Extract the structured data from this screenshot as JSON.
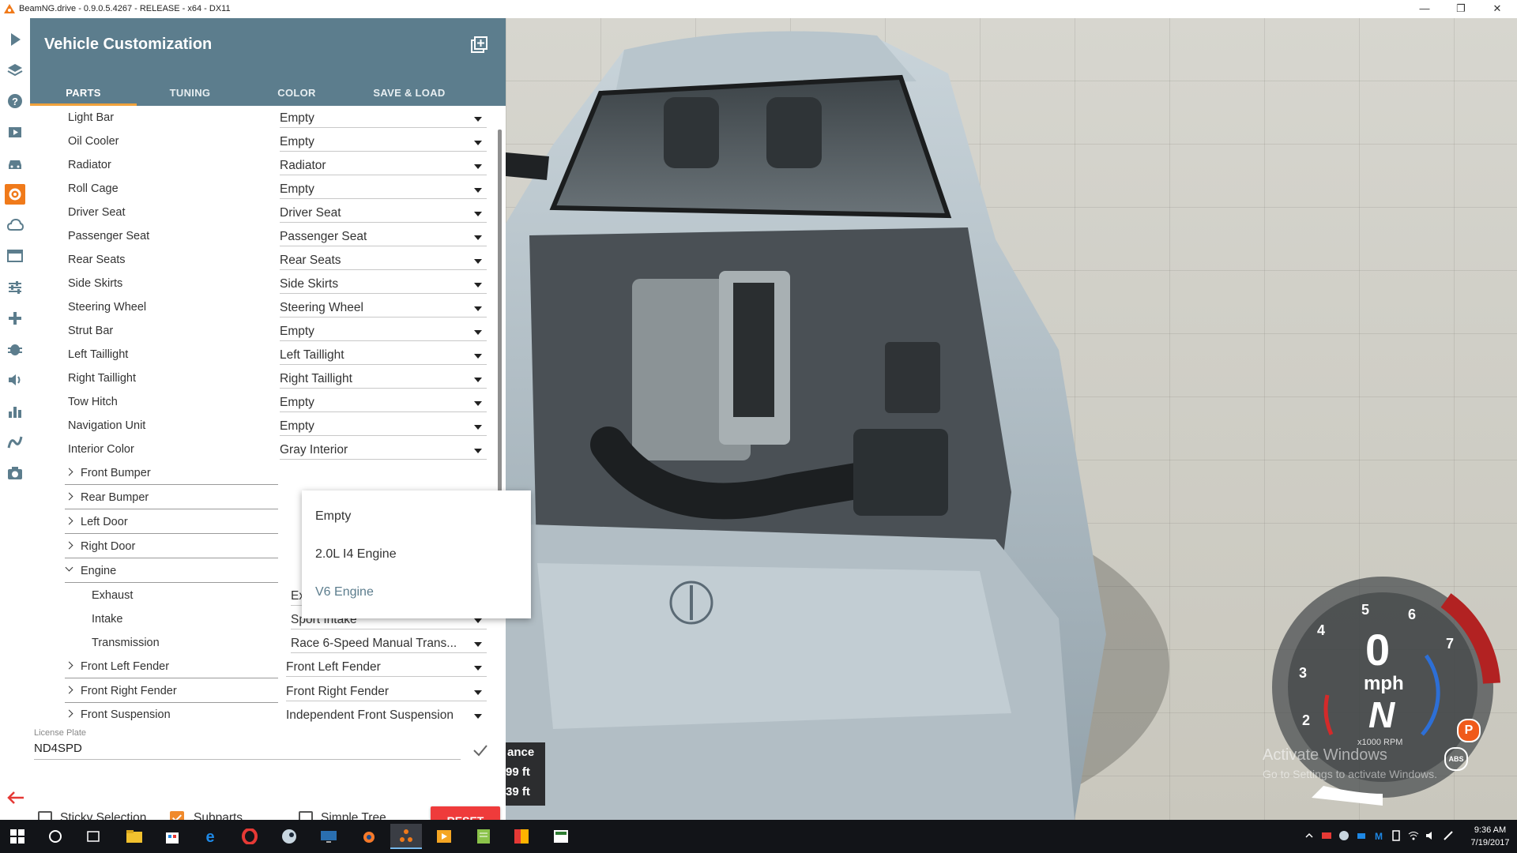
{
  "window": {
    "title": "BeamNG.drive - 0.9.0.5.4267 - RELEASE - x64 - DX11",
    "minimize": "—",
    "restore": "❐",
    "close": "✕"
  },
  "panel": {
    "title": "Vehicle Customization",
    "tabs": [
      "PARTS",
      "TUNING",
      "COLOR",
      "SAVE & LOAD"
    ],
    "active_tab": "PARTS"
  },
  "parts": [
    {
      "label": "Light Bar",
      "value": "Empty"
    },
    {
      "label": "Oil Cooler",
      "value": "Empty"
    },
    {
      "label": "Radiator",
      "value": "Radiator"
    },
    {
      "label": "Roll Cage",
      "value": "Empty"
    },
    {
      "label": "Driver Seat",
      "value": "Driver Seat"
    },
    {
      "label": "Passenger Seat",
      "value": "Passenger Seat"
    },
    {
      "label": "Rear Seats",
      "value": "Rear Seats"
    },
    {
      "label": "Side Skirts",
      "value": "Side Skirts"
    },
    {
      "label": "Steering Wheel",
      "value": "Steering Wheel"
    },
    {
      "label": "Strut Bar",
      "value": "Empty"
    },
    {
      "label": "Left Taillight",
      "value": "Left Taillight"
    },
    {
      "label": "Right Taillight",
      "value": "Right Taillight"
    },
    {
      "label": "Tow Hitch",
      "value": "Empty"
    },
    {
      "label": "Navigation Unit",
      "value": "Empty"
    },
    {
      "label": "Interior Color",
      "value": "Gray Interior"
    }
  ],
  "groups": [
    {
      "label": "Front Bumper"
    },
    {
      "label": "Rear Bumper"
    },
    {
      "label": "Left Door"
    },
    {
      "label": "Right Door"
    },
    {
      "label": "Engine"
    }
  ],
  "engine_subparts": [
    {
      "label": "Exhaust",
      "value": "Exhaust"
    },
    {
      "label": "Intake",
      "value": "Sport Intake"
    },
    {
      "label": "Transmission",
      "value": "Race 6-Speed Manual Trans..."
    }
  ],
  "more_groups": [
    {
      "label": "Front Left Fender",
      "value": "Front Left Fender"
    },
    {
      "label": "Front Right Fender",
      "value": "Front Right Fender"
    },
    {
      "label": "Front Suspension",
      "value": "Independent Front Suspension"
    }
  ],
  "dropdown": {
    "options": [
      "Empty",
      "2.0L I4 Engine",
      "V6 Engine"
    ],
    "selected": "V6 Engine"
  },
  "license": {
    "label": "License Plate",
    "value": "ND4SPD"
  },
  "footer": {
    "sticky_selection": {
      "label": "Sticky Selection",
      "checked": false
    },
    "subparts": {
      "label": "Subparts",
      "checked": true
    },
    "simple_tree": {
      "label": "Simple Tree",
      "checked": false
    },
    "reset": "RESET"
  },
  "distance": {
    "label": "ance",
    "lines": [
      "99 ft",
      "39 ft"
    ]
  },
  "gauge": {
    "speed": "0",
    "unit": "mph",
    "gear": "N",
    "rpm_label": "x1000 RPM",
    "ticks": [
      "2",
      "3",
      "4",
      "5",
      "6",
      "7"
    ],
    "parking": "P",
    "abs": "ABS"
  },
  "watermark": {
    "line1": "Activate Windows",
    "line2": "Go to Settings to activate Windows."
  },
  "clock": {
    "time": "9:36 AM",
    "date": "7/19/2017"
  },
  "rail_icons": [
    "play-icon",
    "layers-icon",
    "help-icon",
    "video-icon",
    "car-icon",
    "parts-icon",
    "cloud-icon",
    "window-icon",
    "sliders-icon",
    "gamepad-icon",
    "bug-icon",
    "sound-icon",
    "stats-icon",
    "road-icon",
    "camera-icon"
  ],
  "accent": "#5c7d8d",
  "highlight": "#f0a23c"
}
